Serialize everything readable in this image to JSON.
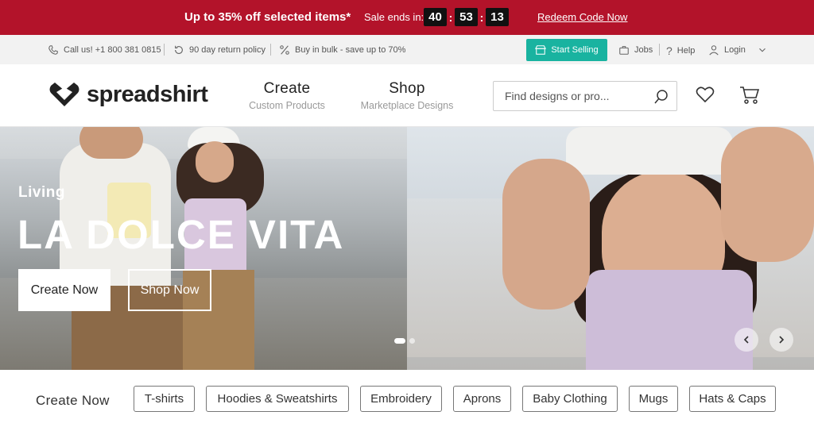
{
  "promo": {
    "headline": "Up to 35% off selected items*",
    "sale_label": "Sale ends in:",
    "timer": [
      "40",
      "53",
      "13"
    ],
    "redeem_label": "Redeem Code Now",
    "bg_color": "#b3132a"
  },
  "utility": {
    "call": "Call us! +1 800 381 0815",
    "returns": "90 day return policy",
    "bulk": "Buy in bulk - save up to 70%",
    "start_selling": "Start Selling",
    "jobs": "Jobs",
    "help": "Help",
    "login": "Login",
    "accent_color": "#19b3a0"
  },
  "header": {
    "logo_text": "spreadshirt",
    "nav": [
      {
        "title": "Create",
        "subtitle": "Custom Products"
      },
      {
        "title": "Shop",
        "subtitle": "Marketplace Designs"
      }
    ],
    "search_placeholder": "Find designs or pro..."
  },
  "hero": {
    "eyebrow": "Living",
    "title": "LA DOLCE VITA",
    "create_button": "Create Now",
    "shop_button": "Shop Now",
    "prev_icon": "chevron-left-icon",
    "next_icon": "chevron-right-icon"
  },
  "categories": {
    "label": "Create Now",
    "items": [
      "T-shirts",
      "Hoodies & Sweatshirts",
      "Embroidery",
      "Aprons",
      "Baby Clothing",
      "Mugs",
      "Hats & Caps"
    ]
  }
}
